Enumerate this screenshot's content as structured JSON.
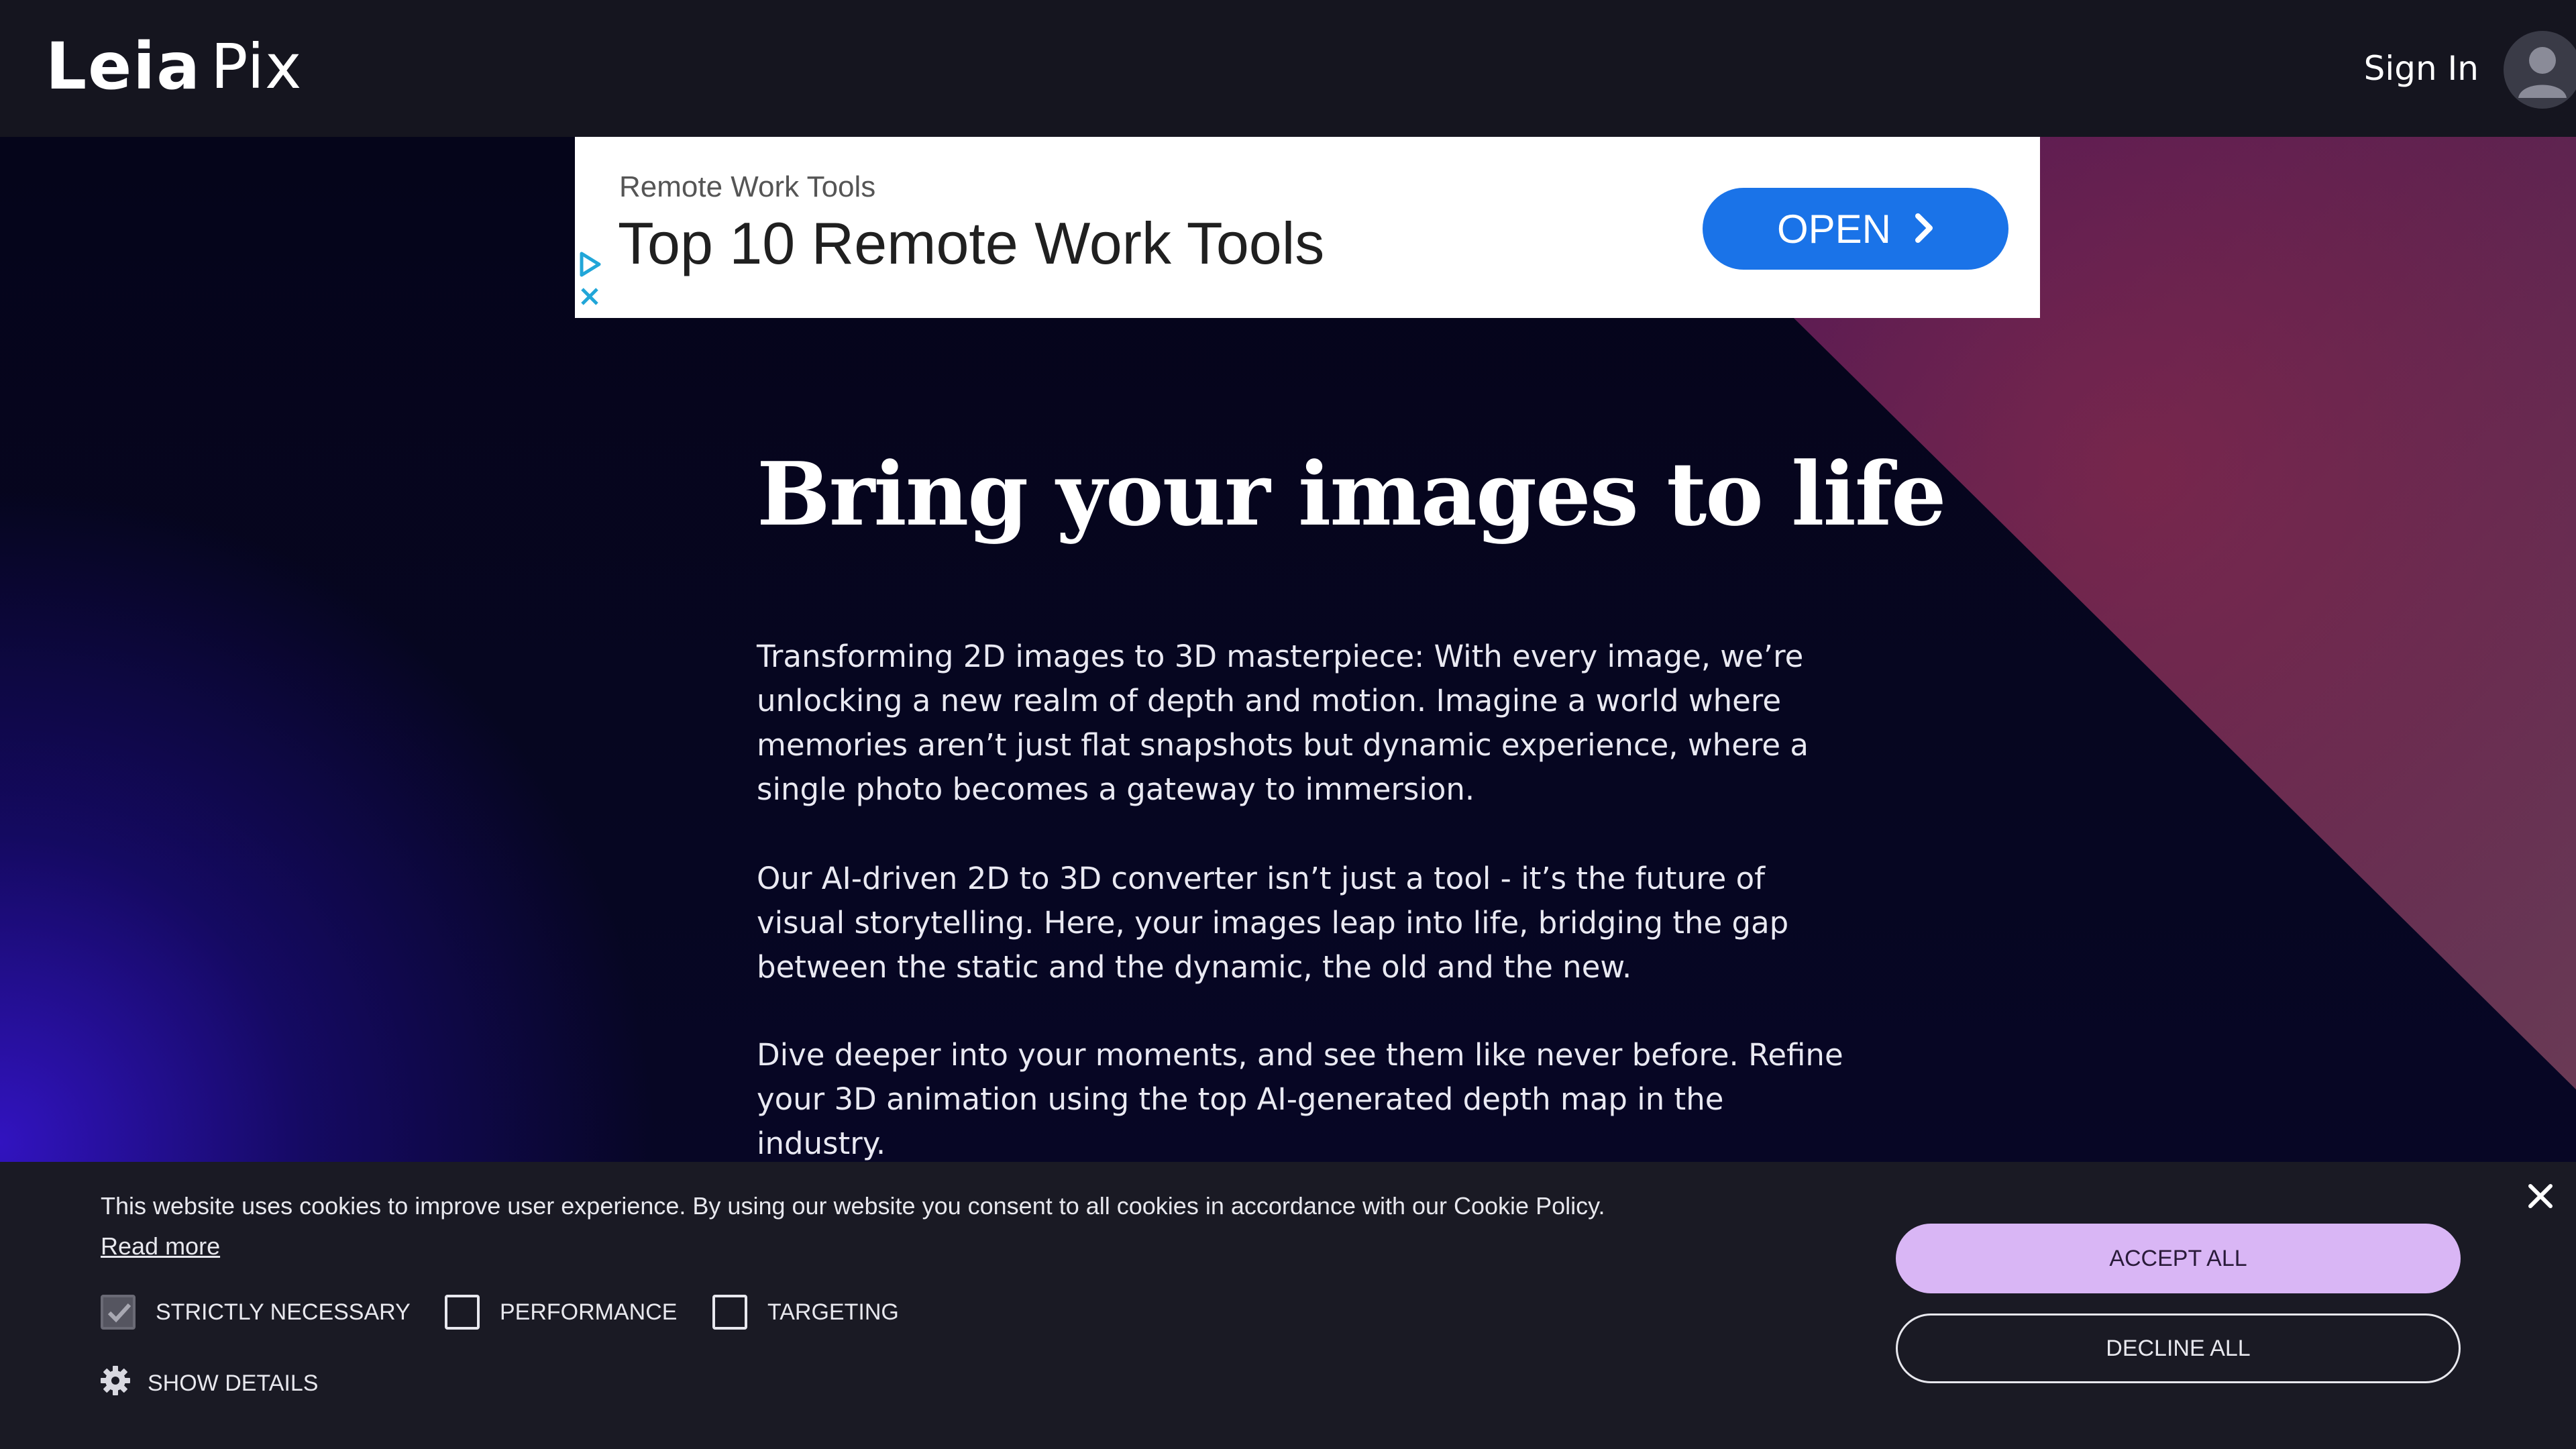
{
  "header": {
    "logo_leia": "Leia",
    "logo_pix": "Pix",
    "sign_in_label": "Sign In",
    "avatar_icon": "user-avatar-icon"
  },
  "ad": {
    "eyebrow": "Remote Work Tools",
    "title": "Top 10 Remote Work Tools",
    "cta_label": "OPEN",
    "cta_icon": "chevron-right-icon",
    "adchoices_icon": "play-triangle-icon",
    "close_icon": "close-icon",
    "cta_color": "#1a73e8"
  },
  "hero": {
    "headline": "Bring your images to life",
    "paragraphs": [
      "Transforming 2D images to 3D masterpiece: With every image, we’re unlocking a new realm of depth and motion. Imagine a world where memories aren’t just flat snapshots but dynamic experience, where a single photo becomes a gateway to immersion.",
      "Our AI-driven 2D to 3D converter isn’t just a tool - it’s the future of visual storytelling. Here, your images leap into life, bridging the gap between the static and the dynamic, the old and the new.",
      "Dive deeper into your moments, and see them like never before. Refine your 3D animation using the top AI-generated depth map in the industry."
    ]
  },
  "cookie": {
    "message": "This website uses cookies to improve user experience. By using our website you consent to all cookies in accordance with our Cookie Policy.",
    "read_more": "Read more",
    "options": [
      {
        "label": "STRICTLY NECESSARY",
        "checked": true
      },
      {
        "label": "PERFORMANCE",
        "checked": false
      },
      {
        "label": "TARGETING",
        "checked": false
      }
    ],
    "show_details": "SHOW DETAILS",
    "accept_all": "ACCEPT ALL",
    "decline_all": "DECLINE ALL",
    "accept_color": "#d9b6f5"
  }
}
